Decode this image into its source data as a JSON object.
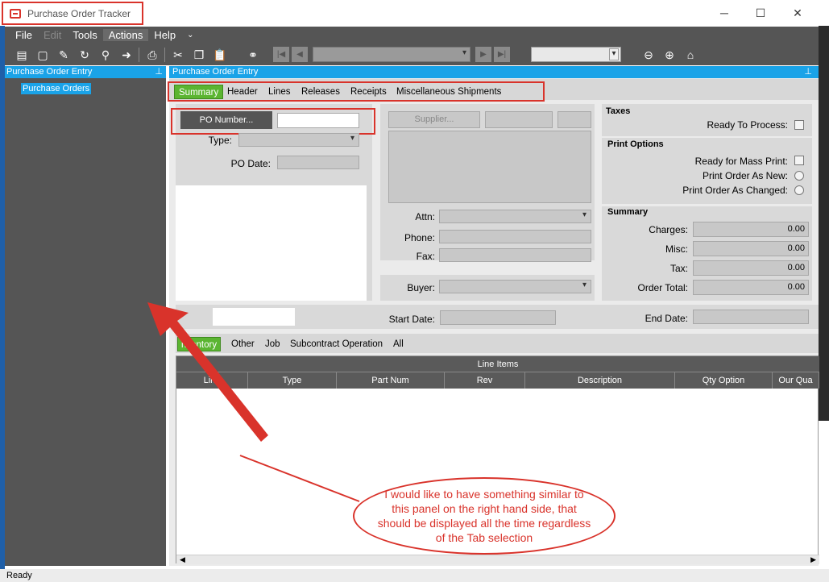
{
  "window": {
    "title": "Purchase Order Tracker",
    "controls": {
      "minimize": "─",
      "maximize": "☐",
      "close": "✕"
    }
  },
  "menubar": {
    "items": [
      {
        "label": "File",
        "state": "normal"
      },
      {
        "label": "Edit",
        "state": "disabled"
      },
      {
        "label": "Tools",
        "state": "normal"
      },
      {
        "label": "Actions",
        "state": "active"
      },
      {
        "label": "Help",
        "state": "normal"
      }
    ],
    "overflow": "⌄"
  },
  "toolbar": {
    "icons": [
      "open-book-icon",
      "new-page-icon",
      "attach-icon",
      "refresh-icon",
      "clear-icon",
      "forward-icon",
      "print-icon",
      "cut-icon",
      "copy-icon",
      "paste-icon",
      "binoculars-icon",
      "first-icon",
      "prev-icon",
      "next-icon",
      "last-icon",
      "back-icon",
      "go-forward-icon",
      "home-icon"
    ]
  },
  "left_panel": {
    "header": "Purchase Order Entry",
    "pin": "⊥",
    "tree_item": "Purchase Orders"
  },
  "main_panel": {
    "header": "Purchase Order Entry",
    "pin": "⊥",
    "tabs": [
      "Summary",
      "Header",
      "Lines",
      "Releases",
      "Receipts",
      "Miscellaneous Shipments"
    ],
    "active_tab": "Summary",
    "po_number_button": "PO Number...",
    "po_number_value": "",
    "type_label": "Type:",
    "po_date_label": "PO Date:",
    "supplier_button": "Supplier...",
    "attn_label": "Attn:",
    "phone_label": "Phone:",
    "fax_label": "Fax:",
    "buyer_label": "Buyer:",
    "start_date_label": "Start Date:",
    "end_date_label": "End Date:",
    "taxes": {
      "title": "Taxes",
      "ready_to_process": "Ready To Process:"
    },
    "print_options": {
      "title": "Print Options",
      "ready_for_mass_print": "Ready for Mass Print:",
      "print_as_new": "Print Order As New:",
      "print_as_changed": "Print Order As Changed:"
    },
    "summary": {
      "title": "Summary",
      "charges_label": "Charges:",
      "charges_value": "0.00",
      "misc_label": "Misc:",
      "misc_value": "0.00",
      "tax_label": "Tax:",
      "tax_value": "0.00",
      "order_total_label": "Order Total:",
      "order_total_value": "0.00"
    },
    "bottom_tabs": [
      "nventory",
      "Other",
      "Job",
      "Subcontract Operation",
      "All"
    ],
    "grid": {
      "title": "Line Items",
      "columns": [
        "Line",
        "Type",
        "Part Num",
        "Rev",
        "Description",
        "Qty Option",
        "Our Qua"
      ]
    }
  },
  "statusbar": {
    "text": "Ready"
  },
  "annotation": {
    "text": "I would like to have something similar to this panel on the right hand side, that should be displayed all the time regardless of the Tab selection",
    "color": "#d9332b"
  },
  "colors": {
    "accent_blue": "#1aa3e8",
    "tab_green": "#5bb531",
    "chrome_gray": "#555555",
    "annotation_red": "#d9332b"
  }
}
